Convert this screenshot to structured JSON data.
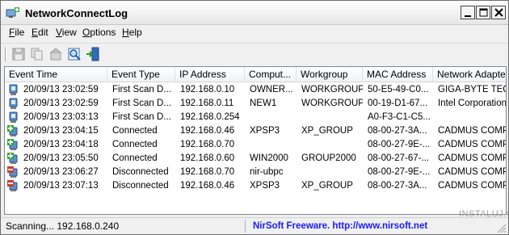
{
  "window": {
    "title": "NetworkConnectLog"
  },
  "menu": [
    {
      "first": "F",
      "rest": "ile"
    },
    {
      "first": "E",
      "rest": "dit"
    },
    {
      "first": "V",
      "rest": "iew"
    },
    {
      "first": "O",
      "rest": "ptions"
    },
    {
      "first": "H",
      "rest": "elp"
    }
  ],
  "toolbar": {
    "icons": [
      "save-icon",
      "copy-icon",
      "properties-icon",
      "refresh-icon",
      "exit-icon"
    ]
  },
  "columns": [
    "Event Time",
    "Event Type",
    "IP Address",
    "Comput...",
    "Workgroup",
    "MAC Address",
    "Network Adapter"
  ],
  "rows": [
    {
      "icon": "computer-blue-icon",
      "time": "20/09/13 23:02:59",
      "type": "First Scan D...",
      "ip": "192.168.0.10",
      "computer": "OWNER...",
      "workgroup": "WORKGROUP",
      "mac": "50-E5-49-C0...",
      "adapter": "GIGA-BYTE TECHN"
    },
    {
      "icon": "computer-blue-icon",
      "time": "20/09/13 23:02:59",
      "type": "First Scan D...",
      "ip": "192.168.0.11",
      "computer": "NEW1",
      "workgroup": "WORKGROUP",
      "mac": "00-19-D1-67...",
      "adapter": "Intel Corporation"
    },
    {
      "icon": "computer-blue-icon",
      "time": "20/09/13 23:03:13",
      "type": "First Scan D...",
      "ip": "192.168.0.254",
      "computer": "",
      "workgroup": "",
      "mac": "A0-F3-C1-C5...",
      "adapter": ""
    },
    {
      "icon": "computer-connected-icon",
      "time": "20/09/13 23:04:15",
      "type": "Connected",
      "ip": "192.168.0.46",
      "computer": "XPSP3",
      "workgroup": "XP_GROUP",
      "mac": "08-00-27-3A...",
      "adapter": "CADMUS COMPUT"
    },
    {
      "icon": "computer-connected-icon",
      "time": "20/09/13 23:04:18",
      "type": "Connected",
      "ip": "192.168.0.70",
      "computer": "",
      "workgroup": "",
      "mac": "08-00-27-9E-...",
      "adapter": "CADMUS COMPUT"
    },
    {
      "icon": "computer-connected-icon",
      "time": "20/09/13 23:05:50",
      "type": "Connected",
      "ip": "192.168.0.60",
      "computer": "WIN2000",
      "workgroup": "GROUP2000",
      "mac": "08-00-27-67-...",
      "adapter": "CADMUS COMPUT"
    },
    {
      "icon": "computer-disconnected-icon",
      "time": "20/09/13 23:06:27",
      "type": "Disconnected",
      "ip": "192.168.0.70",
      "computer": "nir-ubpc",
      "workgroup": "",
      "mac": "08-00-27-9E-...",
      "adapter": "CADMUS COMPUT"
    },
    {
      "icon": "computer-disconnected-icon",
      "time": "20/09/13 23:07:13",
      "type": "Disconnected",
      "ip": "192.168.0.46",
      "computer": "XPSP3",
      "workgroup": "XP_GROUP",
      "mac": "08-00-27-3A...",
      "adapter": "CADMUS COMPUT"
    }
  ],
  "status": {
    "text": "Scanning...   192.168.0.240",
    "link": "NirSoft Freeware.  http://www.nirsoft.net"
  },
  "watermark": "INSTALUJ.CZ"
}
